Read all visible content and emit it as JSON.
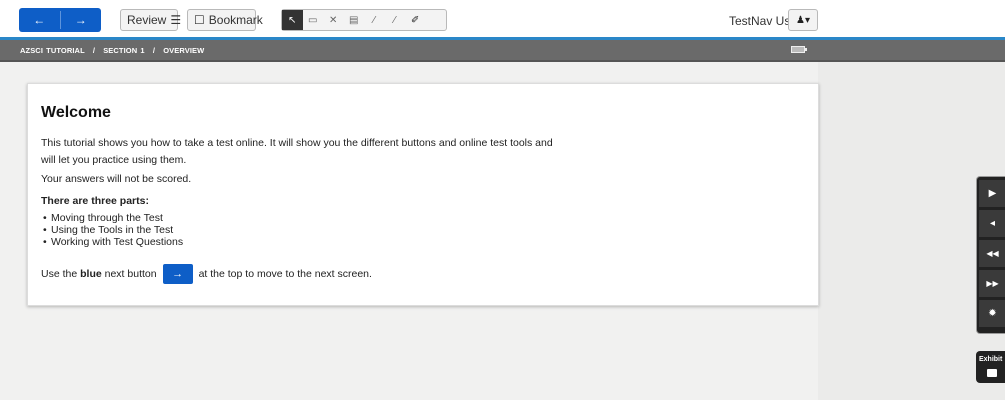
{
  "toolbar": {
    "back_icon": "arrow-left-icon",
    "back_glyph": "←",
    "next_icon": "arrow-right-icon",
    "next_glyph": "→",
    "review_label": "Review",
    "review_icon_glyph": "☰",
    "bookmark_label": "Bookmark",
    "bookmark_icon_glyph": "☐",
    "tools": [
      {
        "name": "pointer-icon",
        "glyph": "↖",
        "active": true
      },
      {
        "name": "note-icon",
        "glyph": "▭"
      },
      {
        "name": "answer-eliminator-icon",
        "glyph": "✕"
      },
      {
        "name": "calculator-icon",
        "glyph": "▤"
      },
      {
        "name": "highlighter-icon",
        "glyph": "⁄"
      },
      {
        "name": "eraser-icon",
        "glyph": "⁄"
      },
      {
        "name": "pen-icon",
        "glyph": "✐"
      }
    ],
    "user_name": "TestNav User",
    "user_icon_glyph": "♟▾",
    "accent_color": "#0e5ec7"
  },
  "breadcrumb": {
    "items": [
      "AZSCI TUTORIAL",
      "SECTION 1",
      "OVERVIEW"
    ],
    "separator": "/"
  },
  "content": {
    "title": "Welcome",
    "intro": "This tutorial shows you how to take a test online. It will show you the different buttons and online test tools and will let you practice using them.",
    "not_scored": "Your answers will not be scored.",
    "parts_heading": "There are three parts:",
    "parts": [
      "Moving through the Test",
      "Using the Tools in the Test",
      "Working with Test Questions"
    ],
    "final_pre": "Use the ",
    "final_bold": "blue",
    "final_mid": " next button",
    "final_button_glyph": "→",
    "final_post": "at the top to move to the next screen."
  },
  "side_tools": [
    {
      "name": "play-icon",
      "glyph": "▶"
    },
    {
      "name": "megaphone-icon",
      "glyph": "◂"
    },
    {
      "name": "rewind-icon",
      "glyph": "◀◀"
    },
    {
      "name": "fast-forward-icon",
      "glyph": "▶▶"
    },
    {
      "name": "gear-icon",
      "glyph": "✹"
    }
  ],
  "exhibit": {
    "label": "Exhibit",
    "icon": "folder-icon"
  }
}
